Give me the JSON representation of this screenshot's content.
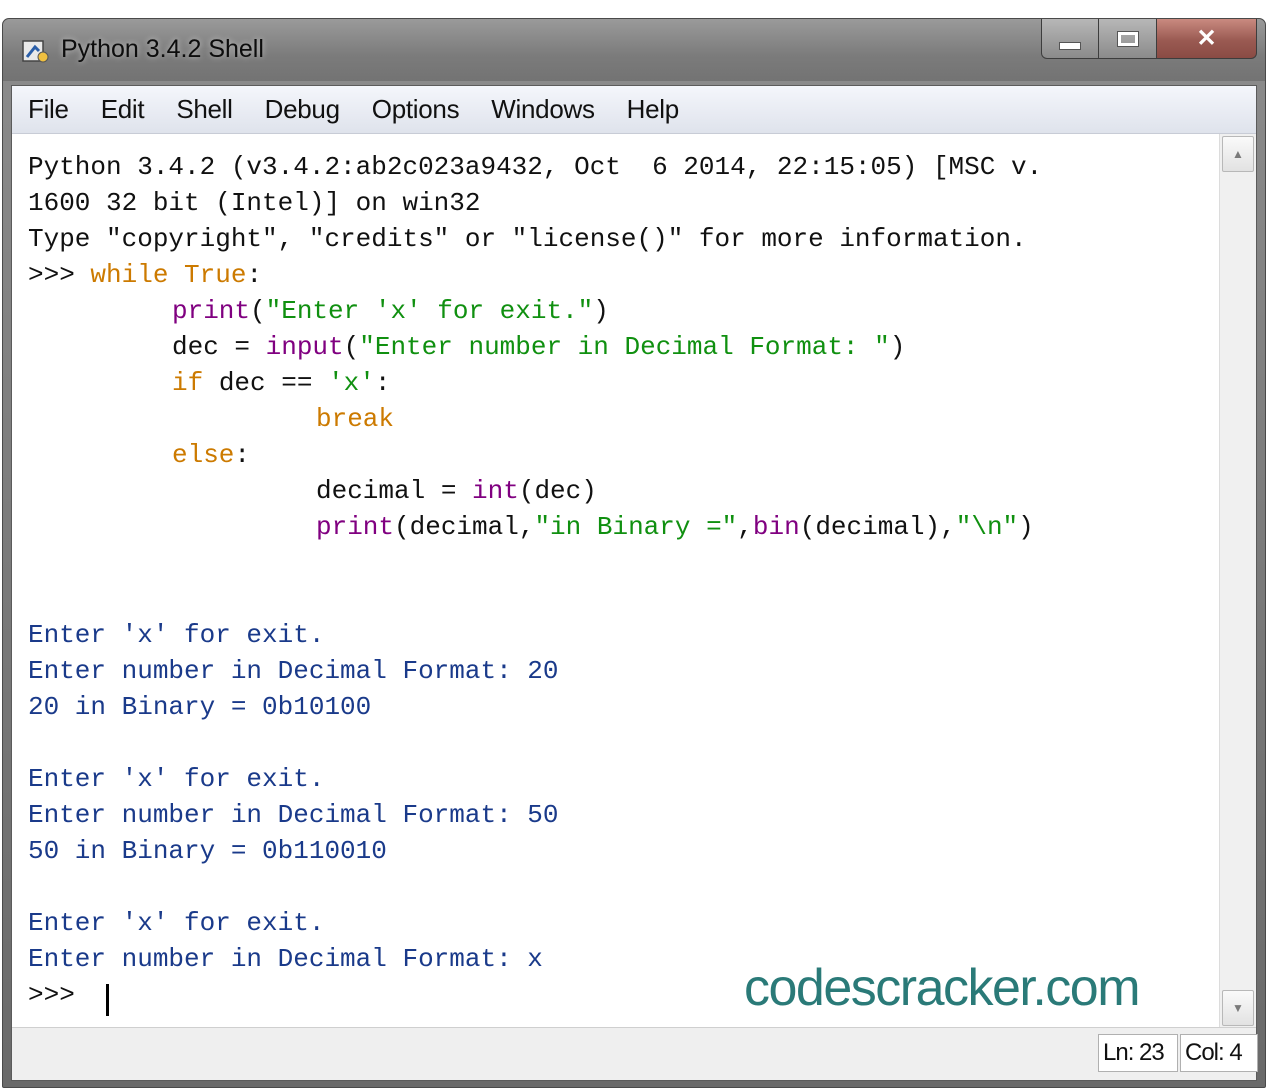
{
  "window": {
    "title": "Python 3.4.2 Shell",
    "icon": "python-idle-icon",
    "buttons": {
      "minimize": "minimize-icon",
      "maximize": "maximize-icon",
      "close": "✕"
    }
  },
  "menu": [
    "File",
    "Edit",
    "Shell",
    "Debug",
    "Options",
    "Windows",
    "Help"
  ],
  "shell": {
    "banner": [
      "Python 3.4.2 (v3.4.2:ab2c023a9432, Oct  6 2014, 22:15:05) [MSC v.",
      "1600 32 bit (Intel)] on win32",
      "Type \"copyright\", \"credits\" or \"license()\" for more information."
    ],
    "code": {
      "prompt": ">>> ",
      "l1_kw": "while",
      "l1_const": "True",
      "l1_colon": ":",
      "l2_fn": "print",
      "l2_open": "(",
      "l2_str": "\"Enter 'x' for exit.\"",
      "l2_close": ")",
      "l3_var": "dec = ",
      "l3_fn": "input",
      "l3_open": "(",
      "l3_str": "\"Enter number in Decimal Format: \"",
      "l3_close": ")",
      "l4_kw": "if",
      "l4_mid": " dec == ",
      "l4_str": "'x'",
      "l4_colon": ":",
      "l5_kw": "break",
      "l6_kw": "else",
      "l6_colon": ":",
      "l7_var": "decimal = ",
      "l7_fn": "int",
      "l7_rest": "(dec)",
      "l8_fn": "print",
      "l8_a": "(decimal,",
      "l8_str": "\"in Binary =\"",
      "l8_comma": ",",
      "l8_fn2": "bin",
      "l8_b": "(decimal),",
      "l8_str2": "\"\\n\"",
      "l8_c": ")"
    },
    "output": [
      "Enter 'x' for exit.",
      "Enter number in Decimal Format: 20",
      "20 in Binary = 0b10100",
      "Enter 'x' for exit.",
      "Enter number in Decimal Format: 50",
      "50 in Binary = 0b110010",
      "Enter 'x' for exit.",
      "Enter number in Decimal Format: x"
    ],
    "final_prompt": ">>> "
  },
  "watermark": "codescracker.com",
  "status": {
    "line": "Ln: 23",
    "col": "Col: 4"
  },
  "colors": {
    "keyword": "#cc7a00",
    "builtin": "#800080",
    "string": "#109010",
    "output": "#1a3a8a",
    "watermark": "#2a7a78",
    "close_button": "#9a5a52"
  }
}
